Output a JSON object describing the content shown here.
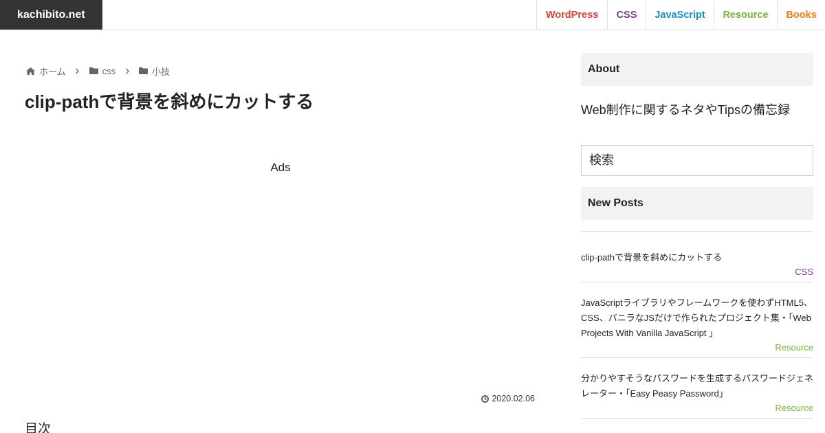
{
  "header": {
    "site_title": "kachibito.net",
    "nav": [
      {
        "label": "WordPress",
        "color": "#d9443a"
      },
      {
        "label": "CSS",
        "color": "#7b3a96"
      },
      {
        "label": "JavaScript",
        "color": "#1a8fd6"
      },
      {
        "label": "Resource",
        "color": "#7ab33a"
      },
      {
        "label": "Books",
        "color": "#ef7d13"
      }
    ]
  },
  "breadcrumb": {
    "home": "ホーム",
    "category": "css",
    "subcategory": "小技",
    "home_icon": "home-icon",
    "folder_icon": "folder-icon",
    "separator_icon": "chevron-right-icon"
  },
  "article": {
    "title": "clip-pathで背景を斜めにカットする",
    "ads_label": "Ads",
    "date": "2020.02.06",
    "date_icon": "clock-icon",
    "toc_title": "目次"
  },
  "sidebar": {
    "about": {
      "heading": "About",
      "text": "Web制作に関するネタやTipsの備忘録"
    },
    "search": {
      "placeholder": "検索"
    },
    "new_posts": {
      "heading": "New Posts",
      "items": [
        {
          "title": "clip-pathで背景を斜めにカットする",
          "category": "CSS",
          "category_color": "#7b3a96"
        },
        {
          "title": "JavaScriptライブラリやフレームワークを使わずHTML5、CSS、バニラなJSだけで作られたプロジェクト集・「Web Projects With Vanilla JavaScript 」",
          "category": "Resource",
          "category_color": "#7ab33a"
        },
        {
          "title": "分かりやすそうなパスワードを生成するパスワードジェネレーター・「Easy Peasy Password」",
          "category": "Resource",
          "category_color": "#7ab33a"
        }
      ]
    }
  }
}
